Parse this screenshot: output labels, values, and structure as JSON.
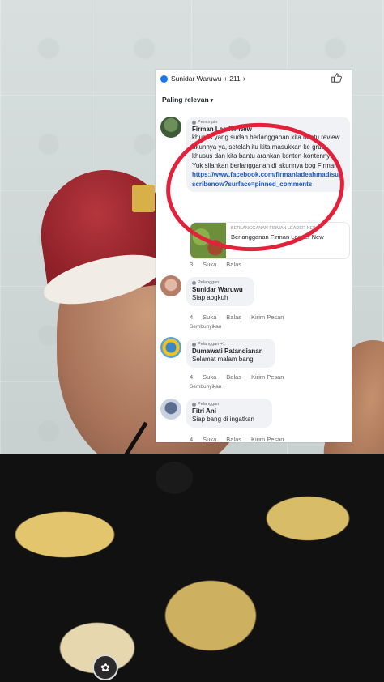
{
  "header": {
    "reactions_text": "Sunidar Waruwu + 211",
    "filter_label": "Paling relevan"
  },
  "comments": [
    {
      "tag": "Pemimpin",
      "author": "Firman Leader New",
      "text": "khusus yang sudah berlangganan kita bantu review akunnya ya, setelah itu kita masukkan ke grup khusus dan kita bantu arahkan konten-kontennya. Yuk silahkan berlangganan di akunnya bbg Firman",
      "link": "https://www.facebook.com/firmanladeahmad/subscribenow?surface=pinned_comments",
      "preview_kicker": "BERLANGGANAN FIRMAN LEADER NEW",
      "preview_title": "Berlangganan Firman Leader New",
      "count": "3",
      "like": "Suka",
      "reply": "Balas"
    },
    {
      "tag": "Pelanggan",
      "author": "Sunidar Waruwu",
      "text": "Siap abgkuh",
      "count": "4",
      "like": "Suka",
      "reply": "Balas",
      "message": "Kirim Pesan",
      "hide": "Sembunyikan"
    },
    {
      "tag": "Pelanggan +1",
      "author": "Dumawati Patandianan",
      "text": "Selamat malam bang",
      "count": "4",
      "like": "Suka",
      "reply": "Balas",
      "message": "Kirim Pesan",
      "hide": "Sembunyikan"
    },
    {
      "tag": "Pelanggan",
      "author": "Fitri Ani",
      "text": "Siap bang di ingatkan",
      "count": "4",
      "like": "Suka",
      "reply": "Balas",
      "message": "Kirim Pesan"
    }
  ],
  "colors": {
    "annotation_circle": "#e3213a",
    "link": "#1a56c8",
    "bubble": "#f0f2f5"
  }
}
